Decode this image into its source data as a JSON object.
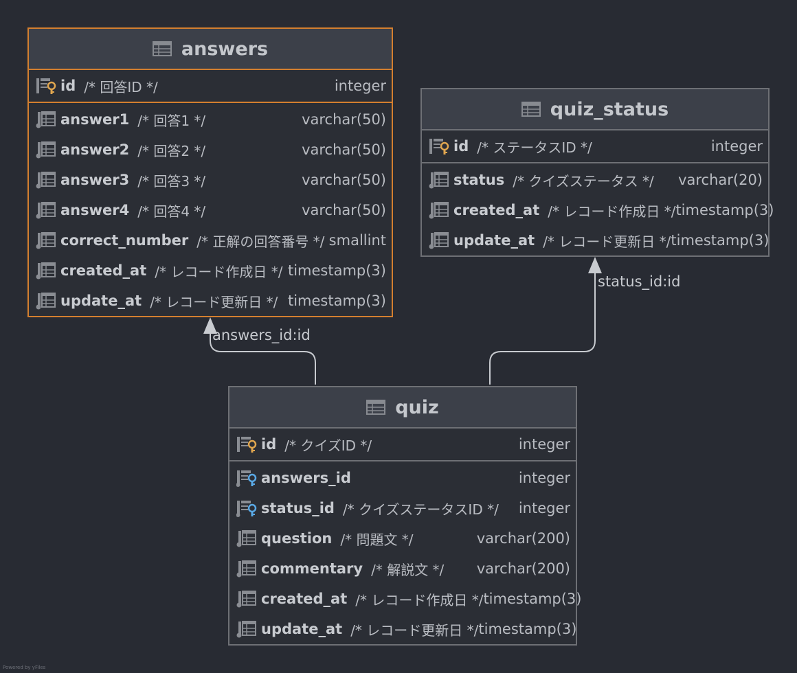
{
  "tables": {
    "answers": {
      "name": "answers",
      "pk": {
        "name": "id",
        "comment": "/* 回答ID */",
        "type": "integer"
      },
      "columns": [
        {
          "name": "answer1",
          "comment": "/* 回答1 */",
          "type": "varchar(50)"
        },
        {
          "name": "answer2",
          "comment": "/* 回答2 */",
          "type": "varchar(50)"
        },
        {
          "name": "answer3",
          "comment": "/* 回答3 */",
          "type": "varchar(50)"
        },
        {
          "name": "answer4",
          "comment": "/* 回答4 */",
          "type": "varchar(50)"
        },
        {
          "name": "correct_number",
          "comment": "/* 正解の回答番号 */",
          "type": "smallint"
        },
        {
          "name": "created_at",
          "comment": "/* レコード作成日 */",
          "type": "timestamp(3)"
        },
        {
          "name": "update_at",
          "comment": "/* レコード更新日 */",
          "type": "timestamp(3)"
        }
      ]
    },
    "quiz_status": {
      "name": "quiz_status",
      "pk": {
        "name": "id",
        "comment": "/* ステータスID */",
        "type": "integer"
      },
      "columns": [
        {
          "name": "status",
          "comment": "/* クイズステータス */",
          "type": "varchar(20)"
        },
        {
          "name": "created_at",
          "comment": "/* レコード作成日 */",
          "type": "timestamp(3)"
        },
        {
          "name": "update_at",
          "comment": "/* レコード更新日 */",
          "type": "timestamp(3)"
        }
      ]
    },
    "quiz": {
      "name": "quiz",
      "pk": {
        "name": "id",
        "comment": "/* クイズID */",
        "type": "integer"
      },
      "columns": [
        {
          "name": "answers_id",
          "comment": "",
          "type": "integer"
        },
        {
          "name": "status_id",
          "comment": "/* クイズステータスID */",
          "type": "integer"
        },
        {
          "name": "question",
          "comment": "/* 問題文 */",
          "type": "varchar(200)"
        },
        {
          "name": "commentary",
          "comment": "/* 解説文 */",
          "type": "varchar(200)"
        },
        {
          "name": "created_at",
          "comment": "/* レコード作成日 */",
          "type": "timestamp(3)"
        },
        {
          "name": "update_at",
          "comment": "/* レコード更新日 */",
          "type": "timestamp(3)"
        }
      ]
    }
  },
  "edges": {
    "answers_label": "answers_id:id",
    "status_label": "status_id:id"
  },
  "footer": "Powered by yFiles",
  "colors": {
    "background": "#282b33",
    "selected_border": "#d47f2f",
    "primary_key": "#e0a64f",
    "foreign_key": "#5aa9e6"
  }
}
